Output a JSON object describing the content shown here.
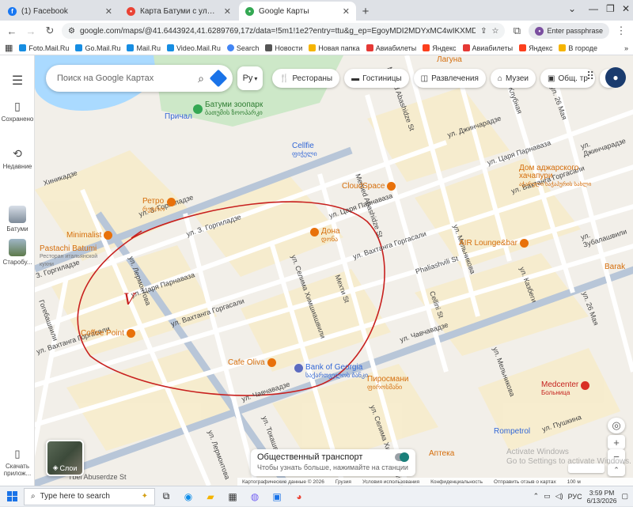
{
  "tabs": [
    {
      "label": "(1) Facebook",
      "favicon": "facebook-icon",
      "color": "#1877f2",
      "glyph": "f"
    },
    {
      "label": "Карта Батуми с улицами и но",
      "favicon": "maps-pin-icon",
      "color": "#ea4335",
      "glyph": "•"
    },
    {
      "label": "Google Карты",
      "favicon": "maps-pin-icon",
      "color": "#34a853",
      "glyph": "•"
    }
  ],
  "browser": {
    "url": "google.com/maps/@41.6443924,41.6289769,17z/data=!5m1!1e2?entry=ttu&g_ep=EgoyMDI2MDYxMC4wIKXMDSoASAFQAw%...",
    "passphrase_label": "Enter passphrase",
    "new_tab": "+"
  },
  "bookmarks": [
    {
      "label": "Foto.Mail.Ru",
      "color": "#168de2"
    },
    {
      "label": "Go.Mail.Ru",
      "color": "#168de2"
    },
    {
      "label": "Mail.Ru",
      "color": "#168de2"
    },
    {
      "label": "Video.Mail.Ru",
      "color": "#168de2"
    },
    {
      "label": "Search",
      "color": "#4285f4"
    },
    {
      "label": "Новости",
      "color": "#555555"
    },
    {
      "label": "Новая папка",
      "color": "#f5b400"
    },
    {
      "label": "Авиабилеты",
      "color": "#e53935"
    },
    {
      "label": "Яндекс",
      "color": "#fc3f1d"
    },
    {
      "label": "Авиабилеты",
      "color": "#e53935"
    },
    {
      "label": "Яндекс",
      "color": "#fc3f1d"
    },
    {
      "label": "В городе",
      "color": "#f5b400"
    }
  ],
  "rail": {
    "saved": "Сохранено",
    "recent": "Недавние",
    "place1": "Батуми",
    "place2": "Старобу...",
    "install": "Скачать прилож..."
  },
  "search": {
    "placeholder": "Поиск на Google Картах"
  },
  "lang_button": "Ру",
  "chips": [
    {
      "label": "Рестораны",
      "icon": "fork-knife-icon"
    },
    {
      "label": "Гостиницы",
      "icon": "bed-icon"
    },
    {
      "label": "Развлечения",
      "icon": "camera-icon"
    },
    {
      "label": "Музеи",
      "icon": "museum-icon"
    },
    {
      "label": "Общ. тр",
      "icon": "bus-icon"
    }
  ],
  "layers_label": "Слои",
  "transit": {
    "title": "Общественный транспорт",
    "subtitle": "Чтобы узнать больше, нажимайте на станции"
  },
  "attribution": [
    "Картографические данные © 2026",
    "Грузия",
    "Условия использования",
    "Конфиденциальность",
    "Отправить отзыв о картах",
    "100 м"
  ],
  "watermark": [
    "Activate Windows",
    "Go to Settings to activate Windows."
  ],
  "streets": [
    "ул. 3. Горгиладзе",
    "ул. З. Горгиладзе",
    "З. Горгиладзе",
    "ул. Царя Парнаваза",
    "ул. Царя Парнаваза",
    "ул. Царя Парнаваза",
    "ул. Вахтанга Горгасали",
    "ул. Вахтанга Горгасали",
    "ул. Вахтанга Горгасали",
    "ул. Вахтанга Горгасали",
    "ул. Джинчарадзе",
    "ул. Джинчарадзе",
    "ул. Чавчавадзе",
    "ул. Чавчавадзе",
    "ул. Пушкина",
    "ул. Зубалашвили",
    "ул. Лермонтова",
    "ул. Лермонтова",
    "ул. Селима Химшиашвили",
    "ул. Селима Химшиашвили",
    "ул. Мельникова",
    "ул. Мельникова",
    "ул. Казбеги",
    "ул. 26 Мая",
    "ул. 26 Мая",
    "ул. Клубная",
    "Memed Abashidze St",
    "Мехти St",
    "Cellini St",
    "Phaliashvili St",
    "ул. Токашвили",
    "Хиникадзе",
    "Гогебашвили",
    "Mamed Abashidze St"
  ],
  "pois": [
    {
      "name": "Батуми зоопарк",
      "sub": "ბათუმის ზოოპარკი",
      "kind": "zoo"
    },
    {
      "name": "Причал",
      "sub": "",
      "kind": "pier"
    },
    {
      "name": "Cellfie",
      "sub": "ფიჭელი",
      "kind": "shop"
    },
    {
      "name": "CloudSpace",
      "sub": "",
      "kind": "food"
    },
    {
      "name": "Ретро",
      "sub": "რეტრო",
      "kind": "food"
    },
    {
      "name": "Minimalist",
      "sub": "",
      "kind": "food"
    },
    {
      "name": "Pastachi Batumi",
      "sub": "Ресторан итальянской кухни",
      "kind": "food"
    },
    {
      "name": "Дона",
      "sub": "დონა",
      "kind": "food"
    },
    {
      "name": "Coffee Point",
      "sub": "",
      "kind": "cafe"
    },
    {
      "name": "Cafe Oliva",
      "sub": "",
      "kind": "cafe"
    },
    {
      "name": "Bank of Georgia",
      "sub": "საქართველოს ბანკი",
      "kind": "bank"
    },
    {
      "name": "Пиросмани",
      "sub": "ფიროსმანი",
      "kind": "food"
    },
    {
      "name": "Дом аджарского хачапури",
      "sub": "აჭარული ხაჭაპურის სახლი",
      "kind": "food"
    },
    {
      "name": "AIR Lounge&bar",
      "sub": "",
      "kind": "food"
    },
    {
      "name": "Medcenter",
      "sub": "Больница",
      "kind": "hospital"
    },
    {
      "name": "Rompetrol",
      "sub": "",
      "kind": "fuel"
    },
    {
      "name": "Лагуна",
      "sub": "",
      "kind": "food"
    },
    {
      "name": "Barak",
      "sub": "",
      "kind": "food"
    },
    {
      "name": "Аптека",
      "sub": "",
      "kind": "pharmacy"
    },
    {
      "name": "Tbel Abusеrdze St",
      "sub": "",
      "kind": "street"
    }
  ],
  "annotation": {
    "mark": "V",
    "color": "#c8201e"
  },
  "taskbar": {
    "search_placeholder": "Type here to search",
    "tray_lang": "РУС",
    "time": "3:59 PM",
    "date": "6/13/2026"
  },
  "colors": {
    "map_bg": "#f2efe9",
    "road": "#ffffff",
    "main_road": "#aebdd0",
    "water": "#aadaff",
    "park": "#c8e6c9",
    "block": "#f8edc9",
    "poi_food": "#e8710a",
    "poi_shop": "#4285f4"
  }
}
